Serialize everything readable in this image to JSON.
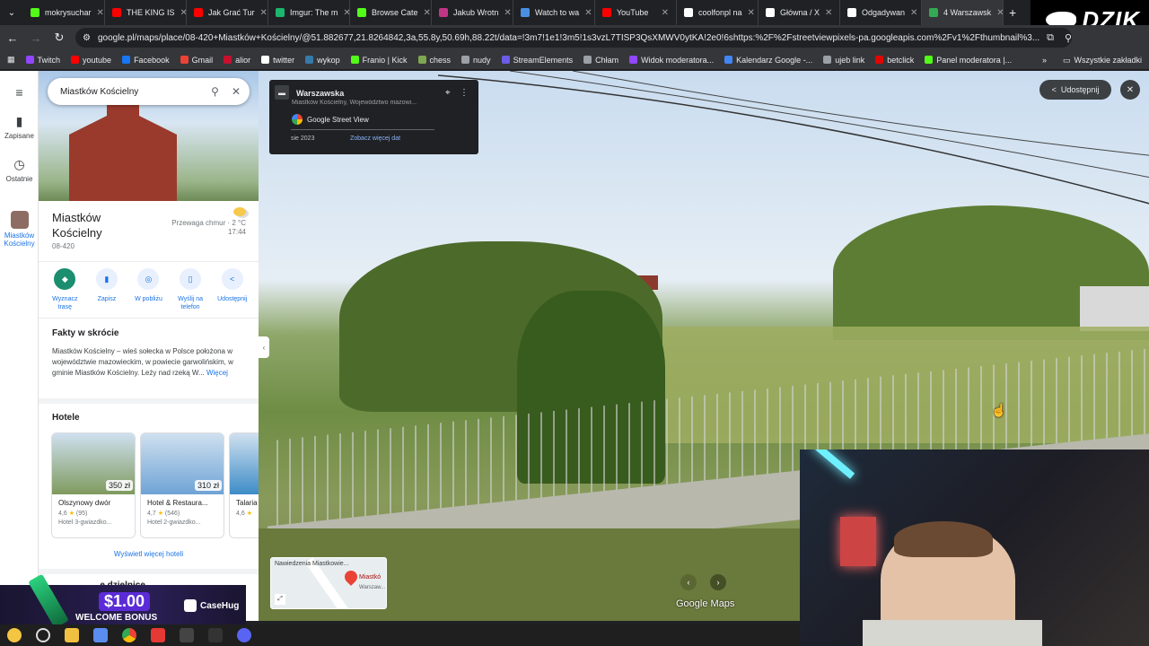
{
  "browser": {
    "tabs": [
      {
        "label": "mokrysuchar",
        "color": "#53fc18",
        "active": false
      },
      {
        "label": "THE KING IS",
        "color": "#ff0000",
        "active": false
      },
      {
        "label": "Jak Grać Tur",
        "color": "#ff0000",
        "active": false
      },
      {
        "label": "Imgur: The m",
        "color": "#1bb76e",
        "active": false
      },
      {
        "label": "Browse Cate",
        "color": "#53fc18",
        "active": false
      },
      {
        "label": "Jakub Wrotn",
        "color": "#c13584",
        "active": false
      },
      {
        "label": "Watch to wa",
        "color": "#4a90e2",
        "active": false
      },
      {
        "label": "YouTube",
        "color": "#ff0000",
        "active": false
      },
      {
        "label": "coolfonpl na",
        "color": "#ffffff",
        "active": false
      },
      {
        "label": "Główna / X",
        "color": "#ffffff",
        "active": false
      },
      {
        "label": "Odgadywan",
        "color": "#ffffff",
        "active": false
      },
      {
        "label": "4 Warszawsk",
        "color": "#34a853",
        "active": true
      }
    ],
    "new_tab": "+",
    "url": "google.pl/maps/place/08-420+Miastków+Kościelny/@51.882677,21.8264842,3a,55.8y,50.69h,88.22t/data=!3m7!1e1!3m5!1s3vzL7TISP3QsXMWV0ytKA!2e0!6shttps:%2F%2Fstreetviewpixels-pa.googleapis.com%2Fv1%2Fthumbnail%3...",
    "bookmarks": [
      {
        "label": "Twitch",
        "color": "#9146ff"
      },
      {
        "label": "youtube",
        "color": "#ff0000"
      },
      {
        "label": "Facebook",
        "color": "#1877f2"
      },
      {
        "label": "Gmail",
        "color": "#ea4335"
      },
      {
        "label": "alior",
        "color": "#c8102e"
      },
      {
        "label": "twitter",
        "color": "#ffffff"
      },
      {
        "label": "wykop",
        "color": "#367aa9"
      },
      {
        "label": "Franio | Kick",
        "color": "#53fc18"
      },
      {
        "label": "chess",
        "color": "#7fa650"
      },
      {
        "label": "nudy",
        "color": "#9aa0a6"
      },
      {
        "label": "StreamElements",
        "color": "#6c5ce7"
      },
      {
        "label": "Chłam",
        "color": "#9aa0a6"
      },
      {
        "label": "Widok moderatora...",
        "color": "#9146ff"
      },
      {
        "label": "Kalendarz Google -...",
        "color": "#4285f4"
      },
      {
        "label": "ujeb link",
        "color": "#9aa0a6"
      },
      {
        "label": "betclick",
        "color": "#e10600"
      },
      {
        "label": "Panel moderatora |...",
        "color": "#53fc18"
      }
    ],
    "bookmarks_overflow": "»",
    "all_bookmarks": "Wszystkie zakładki"
  },
  "overlay": {
    "brand": "DZIK",
    "promo_amount": "$1.00",
    "promo_text": "WELCOME BONUS",
    "promo_brand": "CaseHug"
  },
  "rail": {
    "saved": "Zapisane",
    "recent": "Ostatnie",
    "place": "Miastków Kościelny"
  },
  "panel": {
    "search_value": "Miastków Kościelny",
    "place_name": "Miastków Kościelny",
    "postal_code": "08-420",
    "weather_desc": "Przewaga chmur",
    "weather_temp": "2 °C",
    "weather_time": "17:44",
    "actions": [
      {
        "label": "Wyznacz trasę",
        "icon": "directions-icon",
        "glyph": "◆"
      },
      {
        "label": "Zapisz",
        "icon": "bookmark-icon",
        "glyph": "▮"
      },
      {
        "label": "W pobliżu",
        "icon": "nearby-icon",
        "glyph": "◎"
      },
      {
        "label": "Wyślij na telefon",
        "icon": "phone-icon",
        "glyph": "▯"
      },
      {
        "label": "Udostępnij",
        "icon": "share-icon",
        "glyph": "<"
      }
    ],
    "facts_title": "Fakty w skrócie",
    "facts_text": "Miastków Kościelny – wieś sołecka w Polsce położona w województwie mazowieckim, w powiecie garwolińskim, w gminie Miastków Kościelny. Leży nad rzeką W...",
    "facts_more": "Więcej",
    "hotels_title": "Hotele",
    "hotels": [
      {
        "name": "Olszynowy dwór",
        "price": "350 zł",
        "rating": "4,6",
        "reviews": "(95)",
        "type": "Hotel 3-gwiazdko...",
        "color": "#7f9a5e"
      },
      {
        "name": "Hotel & Restaura...",
        "price": "310 zł",
        "rating": "4,7",
        "reviews": "(546)",
        "type": "Hotel 2-gwiazdko...",
        "color": "#6fa3d6"
      },
      {
        "name": "Talaria",
        "price": "",
        "rating": "4,6",
        "reviews": "",
        "type": "",
        "color": "#3d8cc7"
      }
    ],
    "more_hotels": "Wyświetl więcej hoteli",
    "partial_section": "...e dzielnice"
  },
  "streetview": {
    "title": "Warszawska",
    "subtitle": "Miastków Kościelny, Województwo mazowi...",
    "provider": "Google Street View",
    "date": "sie 2023",
    "see_more": "Zobacz więcej dat",
    "share": "Udostępnij",
    "minimap_label1": "Nawiedzenia Miastkowie...",
    "minimap_label2": "Miastkó",
    "minimap_label3": "Warszaw...",
    "watermark": "Google Maps"
  }
}
